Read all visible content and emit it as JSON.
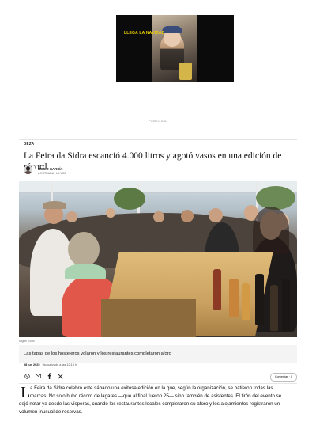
{
  "ad": {
    "video_text": "LLEGA LA NAVIDAD",
    "label": "PUBLICIDAD"
  },
  "article": {
    "section": "DEZA",
    "headline": "La Feira da Sidra escanció 4.000 litros y agotó vasos en una edición de récord",
    "author": {
      "name": "ROCÍO GARCÍA",
      "org": "A ESTRADA / LA VOZ"
    },
    "photo": {
      "credit": "Miguel Souto",
      "caption": "Las tapas de los hosteleros volaron y los restaurantes completaron aforo"
    },
    "date": "08 jun 2025",
    "updated": "· Actualizado a las 12:18 h.",
    "share_icons": [
      "whatsapp-icon",
      "email-icon",
      "facebook-icon",
      "x-icon"
    ],
    "comment_label": "Comentar · 0",
    "dropcap": "L",
    "body_line1": "a Feira da Sidra celebró este sábado una exitosa edición en la que, según la organización, se batieron todas las",
    "body_line2": "marcas. No solo hubo récord de lagares —que al final fueron 25— sino también de asistentes. El tirón del evento se",
    "body_line3": "dejó notar ya desde las vísperas, cuando los restaurantes locales completaron su aforo y los alojamientos registraron un",
    "body_line4": "volumen inusual de reservas."
  }
}
